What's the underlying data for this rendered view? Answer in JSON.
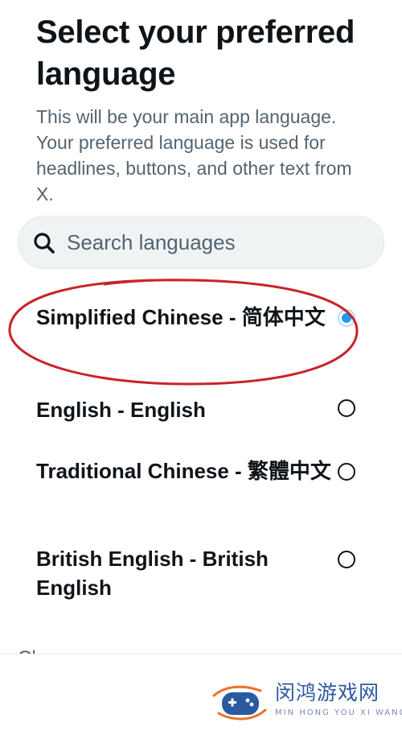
{
  "header": {
    "title": "Select your preferred language",
    "subtitle": "This will be your main app language. Your preferred language is used for headlines, buttons, and other text from X."
  },
  "search": {
    "placeholder": "Search languages",
    "value": "",
    "icon": "search-icon"
  },
  "languages": [
    {
      "label": "Simplified Chinese - 简体中文",
      "selected": true
    },
    {
      "label": "English - English",
      "selected": false
    },
    {
      "label": "Traditional Chinese - 繁體中文",
      "selected": false
    },
    {
      "label": "British English - British English",
      "selected": false
    }
  ],
  "annotation": {
    "shape": "ellipse",
    "color": "#c8232c",
    "target": "Simplified Chinese - 简体中文"
  },
  "colors": {
    "text": "#0f1419",
    "secondary_text": "#536471",
    "search_bg": "#eff3f4",
    "accent": "#1d9bf0"
  },
  "watermark": {
    "title": "闵鸿游戏网",
    "subtitle": "MIN HONG YOU XI WANG"
  }
}
